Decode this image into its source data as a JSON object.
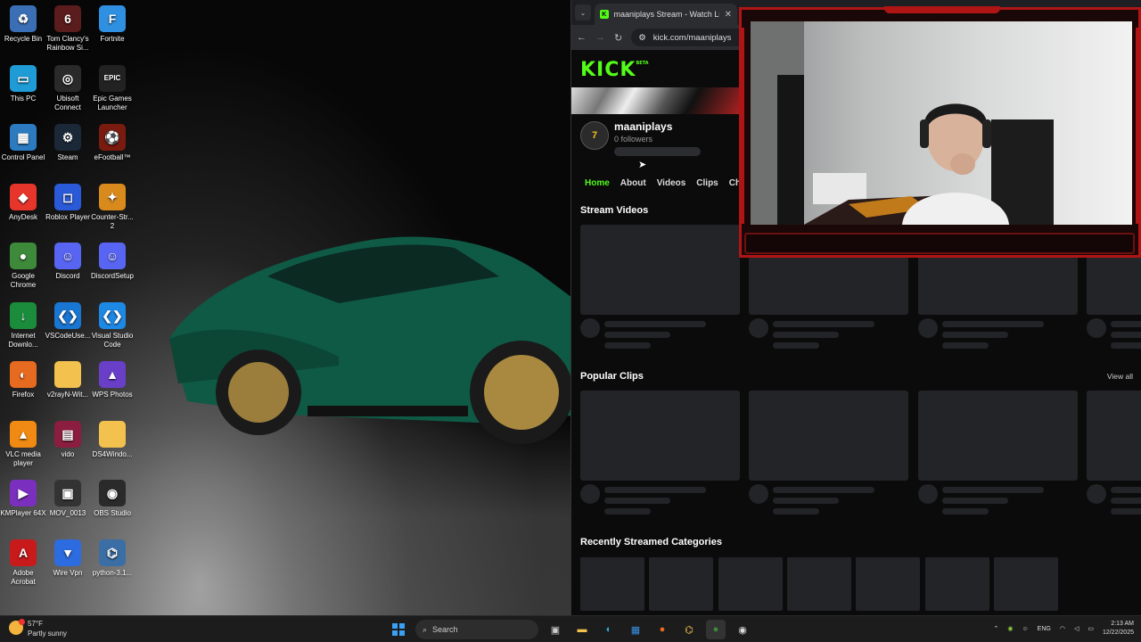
{
  "desktop": {
    "icons": [
      {
        "label": "Recycle Bin",
        "icon": "recycle-bin-icon",
        "glyph": "♻",
        "color": "#3b6fb5"
      },
      {
        "label": "Tom Clancy's Rainbow Si...",
        "icon": "rainbow-six-icon",
        "glyph": "6",
        "color": "#5a1c1c"
      },
      {
        "label": "Fortnite",
        "icon": "fortnite-icon",
        "glyph": "F",
        "color": "#2f8fe0"
      },
      {
        "label": "This PC",
        "icon": "this-pc-icon",
        "glyph": "▭",
        "color": "#1f9bd6"
      },
      {
        "label": "Ubisoft Connect",
        "icon": "ubisoft-icon",
        "glyph": "◎",
        "color": "#2a2a2a"
      },
      {
        "label": "Epic Games Launcher",
        "icon": "epic-games-icon",
        "glyph": "EPIC",
        "color": "#222"
      },
      {
        "label": "Control Panel",
        "icon": "control-panel-icon",
        "glyph": "▦",
        "color": "#2c7bc0"
      },
      {
        "label": "Steam",
        "icon": "steam-icon",
        "glyph": "⚙",
        "color": "#1b2838"
      },
      {
        "label": "eFootball™",
        "icon": "efootball-icon",
        "glyph": "⚽",
        "color": "#7a1b10"
      },
      {
        "label": "AnyDesk",
        "icon": "anydesk-icon",
        "glyph": "◆",
        "color": "#e8352b"
      },
      {
        "label": "Roblox Player",
        "icon": "roblox-icon",
        "glyph": "◻",
        "color": "#2a5ad8"
      },
      {
        "label": "Counter-Str... 2",
        "icon": "counter-strike-icon",
        "glyph": "✦",
        "color": "#d98a1c"
      },
      {
        "label": "Google Chrome",
        "icon": "chrome-icon",
        "glyph": "●",
        "color": "#3c8a3a"
      },
      {
        "label": "Discord",
        "icon": "discord-icon",
        "glyph": "☺",
        "color": "#5865f2"
      },
      {
        "label": "DiscordSetup",
        "icon": "discord-setup-icon",
        "glyph": "☺",
        "color": "#5865f2"
      },
      {
        "label": "Internet Downlo...",
        "icon": "idm-icon",
        "glyph": "↓",
        "color": "#1a8c3c"
      },
      {
        "label": "VSCodeUse...",
        "icon": "vscode-setup-icon",
        "glyph": "❮❯",
        "color": "#1976d2"
      },
      {
        "label": "Visual Studio Code",
        "icon": "vscode-icon",
        "glyph": "❮❯",
        "color": "#1e88e5"
      },
      {
        "label": "Firefox",
        "icon": "firefox-icon",
        "glyph": "◐",
        "color": "#e66a1f"
      },
      {
        "label": "v2rayN-Wit...",
        "icon": "folder-icon",
        "glyph": "",
        "color": "#f2c14e"
      },
      {
        "label": "WPS Photos",
        "icon": "wps-photos-icon",
        "glyph": "▲",
        "color": "#6a3fc8"
      },
      {
        "label": "VLC media player",
        "icon": "vlc-icon",
        "glyph": "▲",
        "color": "#f08a12"
      },
      {
        "label": "vido",
        "icon": "winrar-icon",
        "glyph": "▤",
        "color": "#8b1e3f"
      },
      {
        "label": "DS4Windo...",
        "icon": "folder-icon",
        "glyph": "",
        "color": "#f2c14e"
      },
      {
        "label": "KMPlayer 64X",
        "icon": "kmplayer-icon",
        "glyph": "▶",
        "color": "#7b2fbf"
      },
      {
        "label": "MOV_0013",
        "icon": "video-file-icon",
        "glyph": "▣",
        "color": "#333"
      },
      {
        "label": "OBS Studio",
        "icon": "obs-icon",
        "glyph": "◉",
        "color": "#2a2a2a"
      },
      {
        "label": "Adobe Acrobat",
        "icon": "acrobat-icon",
        "glyph": "A",
        "color": "#c8191b"
      },
      {
        "label": "Wire Vpn",
        "icon": "wire-vpn-icon",
        "glyph": "▼",
        "color": "#2d6be0"
      },
      {
        "label": "python-3.1...",
        "icon": "python-icon",
        "glyph": "⌬",
        "color": "#3a6ea5"
      }
    ]
  },
  "browser": {
    "tab_title": "maaniplays Stream - Watch Liv",
    "favicon": "K",
    "url": "kick.com/maaniplays",
    "logo": "KICK",
    "logo_badge": "BETA",
    "channel": {
      "name": "maaniplays",
      "followers": "0 followers",
      "avatar_text": "7"
    },
    "tabs": [
      "Home",
      "About",
      "Videos",
      "Clips",
      "Chat"
    ],
    "sections": {
      "stream_videos": "Stream Videos",
      "popular_clips": "Popular Clips",
      "view_all": "View all",
      "recent_categories": "Recently Streamed Categories"
    },
    "accent": "#53fc18"
  },
  "taskbar": {
    "weather_temp": "57°F",
    "weather_desc": "Partly sunny",
    "search_placeholder": "Search",
    "lang": "ENG",
    "time": "2:13 AM",
    "date": "12/22/2025"
  }
}
